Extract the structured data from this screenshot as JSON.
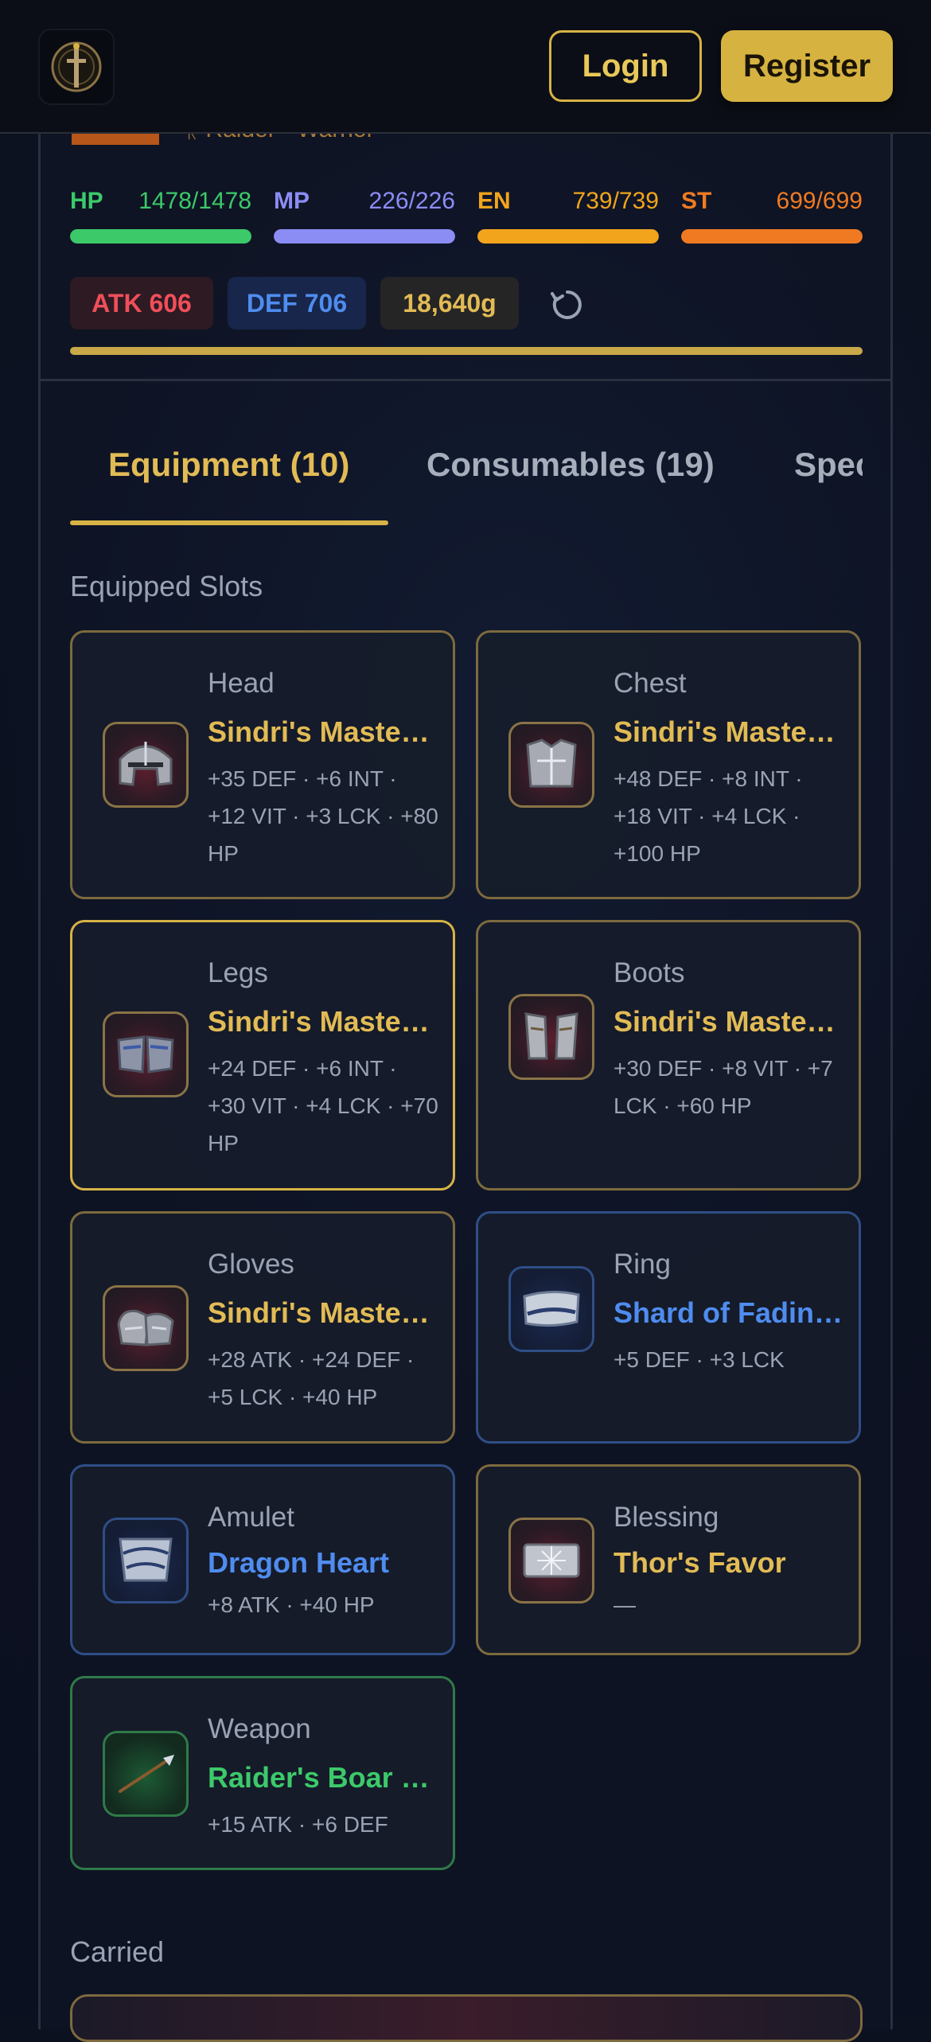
{
  "header": {
    "login_label": "Login",
    "register_label": "Register"
  },
  "character": {
    "subtitle": "Raider · Warrior"
  },
  "stats": [
    {
      "key": "HP",
      "value": "1478/1478",
      "fraction": 1.0,
      "color": "#3cc96a"
    },
    {
      "key": "MP",
      "value": "226/226",
      "fraction": 1.0,
      "color": "#8c8cf5"
    },
    {
      "key": "EN",
      "value": "739/739",
      "fraction": 1.0,
      "color": "#f2a41c"
    },
    {
      "key": "ST",
      "value": "699/699",
      "fraction": 1.0,
      "color": "#f07a22"
    }
  ],
  "badges": {
    "atk": "ATK 606",
    "def": "DEF 706",
    "gold": "18,640g"
  },
  "tabs": [
    {
      "label": "Equipment (10)",
      "active": true
    },
    {
      "label": "Consumables (19)",
      "active": false
    },
    {
      "label": "Special",
      "active": false
    }
  ],
  "sections": {
    "equipped": "Equipped Slots",
    "carried": "Carried"
  },
  "equipped": [
    {
      "slot": "Head",
      "name": "Sindri's Masterwork Helm",
      "desc": "+35 DEF · +6 INT · +12 VIT · +3 LCK · +80 HP",
      "rarity": "gold",
      "icon": "helmet-icon"
    },
    {
      "slot": "Chest",
      "name": "Sindri's Masterwork Chestplate",
      "desc": "+48 DEF · +8 INT · +18 VIT · +4 LCK · +100 HP",
      "rarity": "gold",
      "icon": "chestplate-icon"
    },
    {
      "slot": "Legs",
      "name": "Sindri's Masterwork Greaves",
      "desc": "+24 DEF · +6 INT · +30 VIT · +4 LCK · +70 HP",
      "rarity": "gold",
      "icon": "greaves-icon"
    },
    {
      "slot": "Boots",
      "name": "Sindri's Masterwork Boots",
      "desc": "+30 DEF · +8 VIT · +7 LCK · +60 HP",
      "rarity": "gold",
      "icon": "boots-icon"
    },
    {
      "slot": "Gloves",
      "name": "Sindri's Masterwork Gauntlets",
      "desc": "+28 ATK · +24 DEF · +5 LCK · +40 HP",
      "rarity": "gold",
      "icon": "gauntlets-icon"
    },
    {
      "slot": "Ring",
      "name": "Shard of Fading Light",
      "desc": "+5 DEF · +3 LCK",
      "rarity": "blue",
      "icon": "ring-icon"
    },
    {
      "slot": "Amulet",
      "name": "Dragon Heart",
      "desc": "+8 ATK · +40 HP",
      "rarity": "blue",
      "icon": "amulet-icon"
    },
    {
      "slot": "Blessing",
      "name": "Thor's Favor",
      "desc": "—",
      "rarity": "gold",
      "icon": "blessing-icon"
    },
    {
      "slot": "Weapon",
      "name": "Raider's Boar Spear",
      "desc": "+15 ATK · +6 DEF",
      "rarity": "green",
      "icon": "spear-icon"
    }
  ]
}
